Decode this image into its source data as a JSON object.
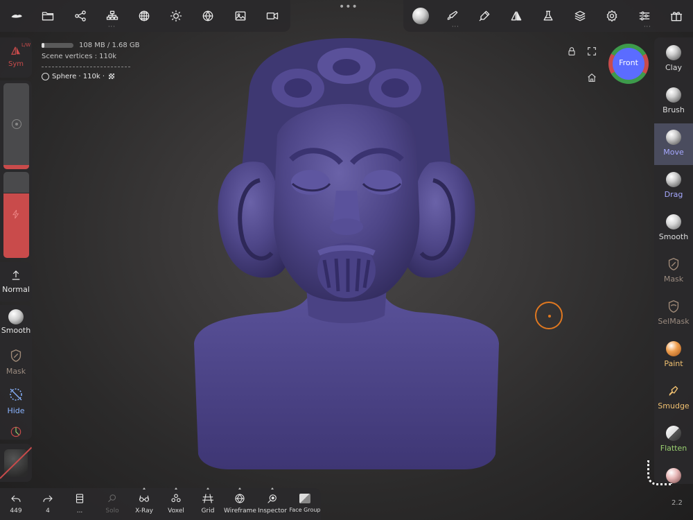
{
  "top_left_icons": [
    "menu-logo-icon",
    "folder-icon",
    "share-nodes-icon",
    "scene-tree-icon",
    "grid-sphere-icon",
    "light-icon",
    "material-icon",
    "image-icon",
    "video-icon"
  ],
  "top_right_icons": [
    "matcap-icon",
    "brush-settings-icon",
    "pen-tool-icon",
    "symmetry-icon",
    "flask-icon",
    "layers-icon",
    "settings-icon",
    "sliders-icon",
    "gift-icon"
  ],
  "info": {
    "memory": "108 MB / 1.68 GB",
    "vertices": "Scene vertices : 110k",
    "mesh": "Sphere · 110k ·"
  },
  "left": {
    "sym": "Sym",
    "sym_sub": "L/W",
    "mode": "Normal",
    "smooth": "Smooth",
    "mask": "Mask",
    "hide": "Hide"
  },
  "view": {
    "gizmo": "Front"
  },
  "tools": [
    {
      "label": "Clay",
      "color": "#dddddd"
    },
    {
      "label": "Brush",
      "color": "#dddddd"
    },
    {
      "label": "Move",
      "color": "#a6a8ff"
    },
    {
      "label": "Drag",
      "color": "#a6a8ff"
    },
    {
      "label": "Smooth",
      "color": "#dddddd"
    },
    {
      "label": "Mask",
      "color": "#9c8c80"
    },
    {
      "label": "SelMask",
      "color": "#9c8c80"
    },
    {
      "label": "Paint",
      "color": "#f0c070"
    },
    {
      "label": "Smudge",
      "color": "#f0c070"
    },
    {
      "label": "Flatten",
      "color": "#9ad070"
    }
  ],
  "bottom": [
    {
      "label": "449",
      "icon": "undo-icon"
    },
    {
      "label": "4",
      "icon": "redo-icon"
    },
    {
      "label": "...",
      "icon": "history-icon"
    },
    {
      "label": "Solo",
      "icon": "solo-search-icon"
    },
    {
      "label": "X-Ray",
      "icon": "xray-glasses-icon"
    },
    {
      "label": "Voxel",
      "icon": "voxel-icon"
    },
    {
      "label": "Grid",
      "icon": "grid-icon"
    },
    {
      "label": "Wireframe",
      "icon": "wireframe-icon"
    },
    {
      "label": "Inspector",
      "icon": "inspector-eye-icon"
    },
    {
      "label": "Face Group",
      "icon": "face-group-icon"
    }
  ],
  "version": "2.2",
  "colors": {
    "accent_red": "#c94b4b",
    "accent_blue": "#5b6cff",
    "cursor": "#e07820"
  }
}
